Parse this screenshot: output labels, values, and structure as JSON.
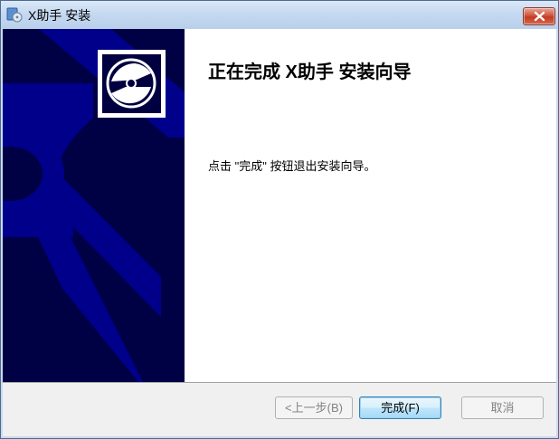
{
  "window": {
    "title": "X助手 安装"
  },
  "page": {
    "heading": "正在完成 X助手 安装向导",
    "body": "点击 \"完成\" 按钮退出安装向导。"
  },
  "buttons": {
    "back": {
      "label": "<上一步(B)",
      "enabled": false
    },
    "finish": {
      "label": "完成(F)",
      "enabled": true,
      "default": true
    },
    "cancel": {
      "label": "取消",
      "enabled": false
    }
  },
  "icons": {
    "title": "installer-disc-icon",
    "close": "close-icon",
    "logo": "disc-logo-icon"
  },
  "colors": {
    "banner_background": "#000044",
    "banner_art": "#00008b",
    "close_button": "#c33b22"
  }
}
